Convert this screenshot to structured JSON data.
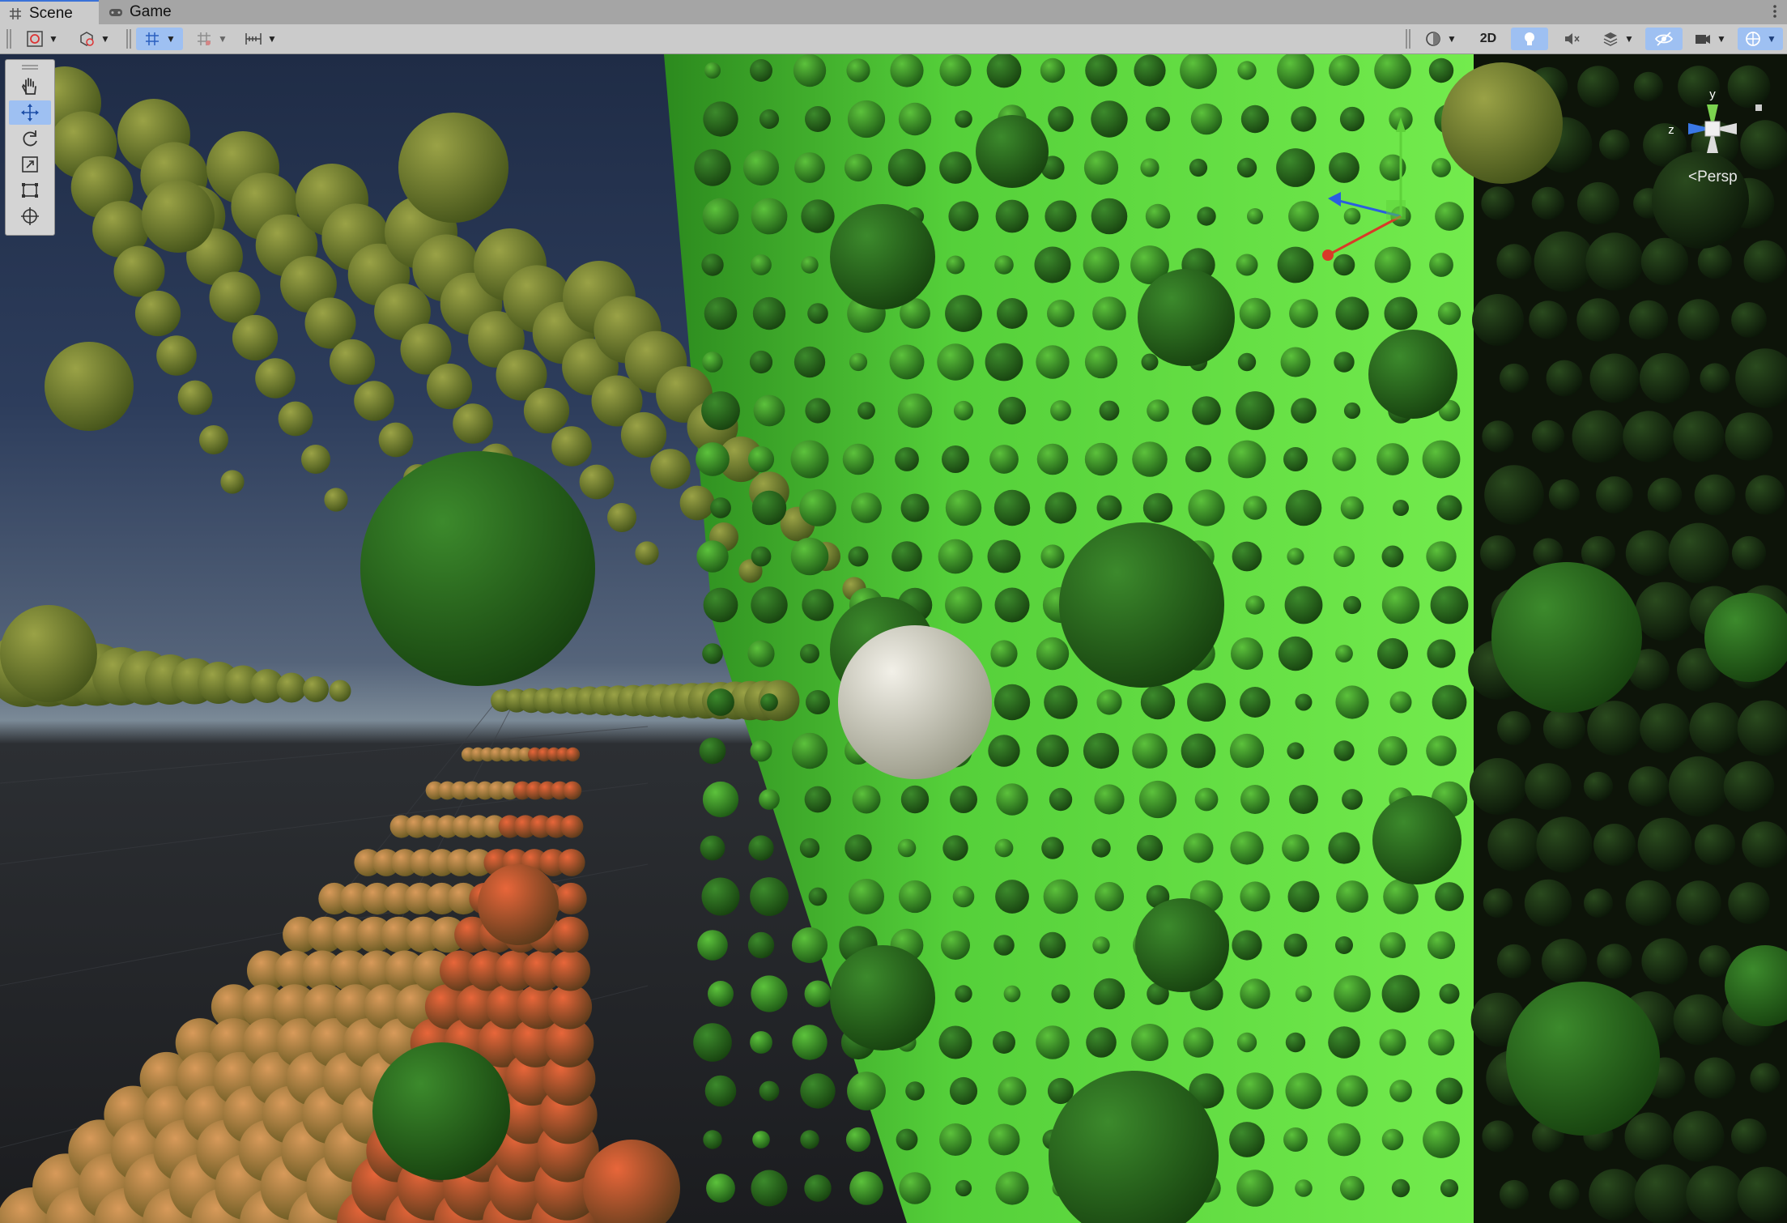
{
  "tabs": [
    {
      "label": "Scene",
      "icon": "hash-icon",
      "active": true
    },
    {
      "label": "Game",
      "icon": "gamepad-icon",
      "active": false
    }
  ],
  "toolbar": {
    "mode_2d_label": "2D",
    "accent_color": "#9ec0f2"
  },
  "tools": [
    {
      "name": "hand-tool",
      "icon": "hand-icon",
      "active": false
    },
    {
      "name": "move-tool",
      "icon": "move-icon",
      "active": true
    },
    {
      "name": "rotate-tool",
      "icon": "rotate-icon",
      "active": false
    },
    {
      "name": "scale-tool",
      "icon": "scale-icon",
      "active": false
    },
    {
      "name": "rect-tool",
      "icon": "rect-icon",
      "active": false
    },
    {
      "name": "transform-tool",
      "icon": "transform-icon",
      "active": false
    }
  ],
  "gizmo": {
    "y_label": "y",
    "z_label": "z",
    "projection_label": "Persp",
    "y_color": "#7bd34f",
    "z_color": "#3a78e6",
    "x_color": "#e03a2a"
  },
  "scene": {
    "description_colors": {
      "green_panel": "#6fe84a",
      "sphere_green": "#2f7a22",
      "sphere_orange": "#c8703a",
      "sky_top": "#1f2c46",
      "ground": "#1b1c1f"
    }
  }
}
